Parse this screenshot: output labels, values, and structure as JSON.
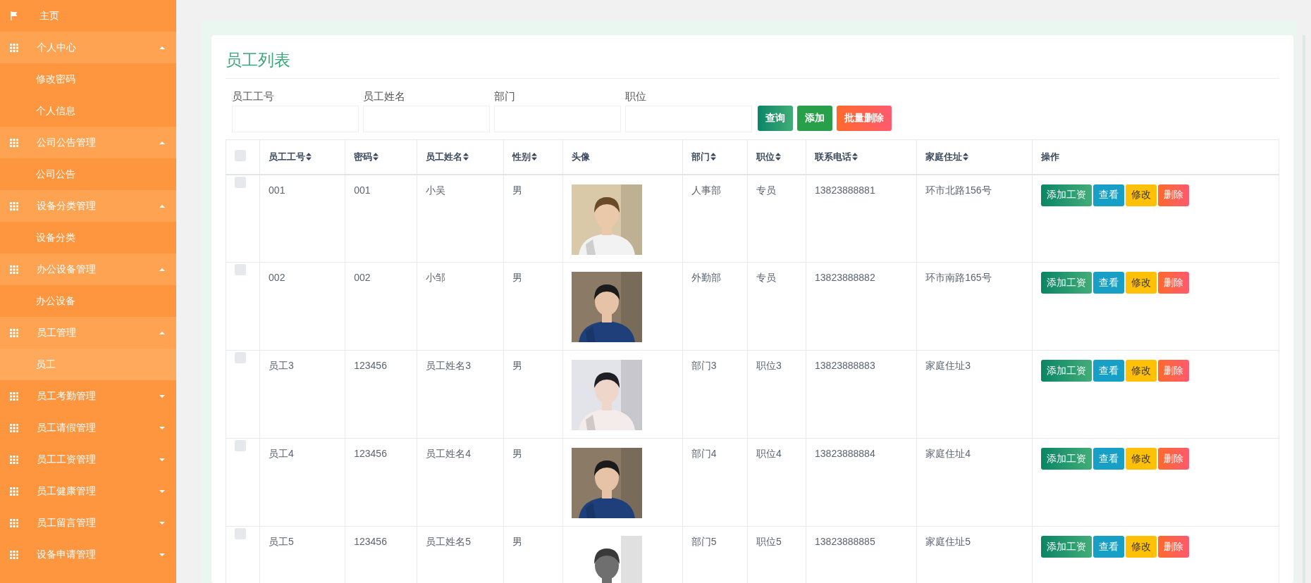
{
  "sidebar": {
    "items": [
      {
        "kind": "link",
        "label": "主页",
        "selected": false
      },
      {
        "kind": "group",
        "label": "个人中心",
        "expanded": true,
        "children": [
          {
            "label": "修改密码",
            "selected": false
          },
          {
            "label": "个人信息",
            "selected": false
          }
        ]
      },
      {
        "kind": "group",
        "label": "公司公告管理",
        "expanded": true,
        "children": [
          {
            "label": "公司公告",
            "selected": false
          }
        ]
      },
      {
        "kind": "group",
        "label": "设备分类管理",
        "expanded": true,
        "children": [
          {
            "label": "设备分类",
            "selected": false
          }
        ]
      },
      {
        "kind": "group",
        "label": "办公设备管理",
        "expanded": true,
        "children": [
          {
            "label": "办公设备",
            "selected": false
          }
        ]
      },
      {
        "kind": "group",
        "label": "员工管理",
        "expanded": true,
        "children": [
          {
            "label": "员工",
            "selected": true
          }
        ]
      },
      {
        "kind": "group",
        "label": "员工考勤管理",
        "expanded": false
      },
      {
        "kind": "group",
        "label": "员工请假管理",
        "expanded": false
      },
      {
        "kind": "group",
        "label": "员工工资管理",
        "expanded": false
      },
      {
        "kind": "group",
        "label": "员工健康管理",
        "expanded": false
      },
      {
        "kind": "group",
        "label": "员工留言管理",
        "expanded": false
      },
      {
        "kind": "group",
        "label": "设备申请管理",
        "expanded": false
      }
    ]
  },
  "page": {
    "title": "员工列表",
    "filters": [
      {
        "label": "员工工号"
      },
      {
        "label": "员工姓名"
      },
      {
        "label": "部门"
      },
      {
        "label": "职位"
      }
    ],
    "buttons": [
      {
        "kind": "query",
        "label": "查询"
      },
      {
        "kind": "add",
        "label": "添加"
      },
      {
        "kind": "delete",
        "label": "批量删除"
      }
    ]
  },
  "table": {
    "select_all": {
      "checked": false
    },
    "columns": [
      {
        "label": "员工工号",
        "sortable": true
      },
      {
        "label": "密码",
        "sortable": true
      },
      {
        "label": "员工姓名",
        "sortable": true
      },
      {
        "label": "性别",
        "sortable": true
      },
      {
        "label": "头像",
        "sortable": false
      },
      {
        "label": "部门",
        "sortable": true
      },
      {
        "label": "职位",
        "sortable": true
      },
      {
        "label": "联系电话",
        "sortable": true
      },
      {
        "label": "家庭住址",
        "sortable": true
      },
      {
        "label": "操作",
        "sortable": false
      }
    ],
    "rows": [
      {
        "checked": false,
        "cells": [
          "001",
          "001",
          "小吴",
          "男"
        ],
        "avatar": {
          "kind": "picture"
        },
        "cells_after": [
          "人事部",
          "专员",
          "13823888881",
          "环市北路156号"
        ],
        "actions": [
          {
            "kind": "salary",
            "label": "添加工资"
          },
          {
            "kind": "view",
            "label": "查看"
          },
          {
            "kind": "edit",
            "label": "修改"
          },
          {
            "kind": "delete",
            "label": "删除"
          }
        ]
      },
      {
        "checked": false,
        "cells": [
          "002",
          "002",
          "小邹",
          "男"
        ],
        "avatar": {
          "kind": "picture"
        },
        "cells_after": [
          "外勤部",
          "专员",
          "13823888882",
          "环市南路165号"
        ],
        "actions": [
          {
            "kind": "salary",
            "label": "添加工资"
          },
          {
            "kind": "view",
            "label": "查看"
          },
          {
            "kind": "edit",
            "label": "修改"
          },
          {
            "kind": "delete",
            "label": "删除"
          }
        ]
      },
      {
        "checked": false,
        "cells": [
          "员工3",
          "123456",
          "员工姓名3",
          "男"
        ],
        "avatar": {
          "kind": "picture"
        },
        "cells_after": [
          "部门3",
          "职位3",
          "13823888883",
          "家庭住址3"
        ],
        "actions": [
          {
            "kind": "salary",
            "label": "添加工资"
          },
          {
            "kind": "view",
            "label": "查看"
          },
          {
            "kind": "edit",
            "label": "修改"
          },
          {
            "kind": "delete",
            "label": "删除"
          }
        ]
      },
      {
        "checked": false,
        "cells": [
          "员工4",
          "123456",
          "员工姓名4",
          "男"
        ],
        "avatar": {
          "kind": "picture"
        },
        "cells_after": [
          "部门4",
          "职位4",
          "13823888884",
          "家庭住址4"
        ],
        "actions": [
          {
            "kind": "salary",
            "label": "添加工资"
          },
          {
            "kind": "view",
            "label": "查看"
          },
          {
            "kind": "edit",
            "label": "修改"
          },
          {
            "kind": "delete",
            "label": "删除"
          }
        ]
      },
      {
        "checked": false,
        "cells": [
          "员工5",
          "123456",
          "员工姓名5",
          "男"
        ],
        "avatar": {
          "kind": "picture"
        },
        "cells_after": [
          "部门5",
          "职位5",
          "13823888885",
          "家庭住址5"
        ],
        "actions": [
          {
            "kind": "salary",
            "label": "添加工资"
          },
          {
            "kind": "view",
            "label": "查看"
          },
          {
            "kind": "edit",
            "label": "修改"
          },
          {
            "kind": "delete",
            "label": "删除"
          }
        ]
      }
    ]
  }
}
